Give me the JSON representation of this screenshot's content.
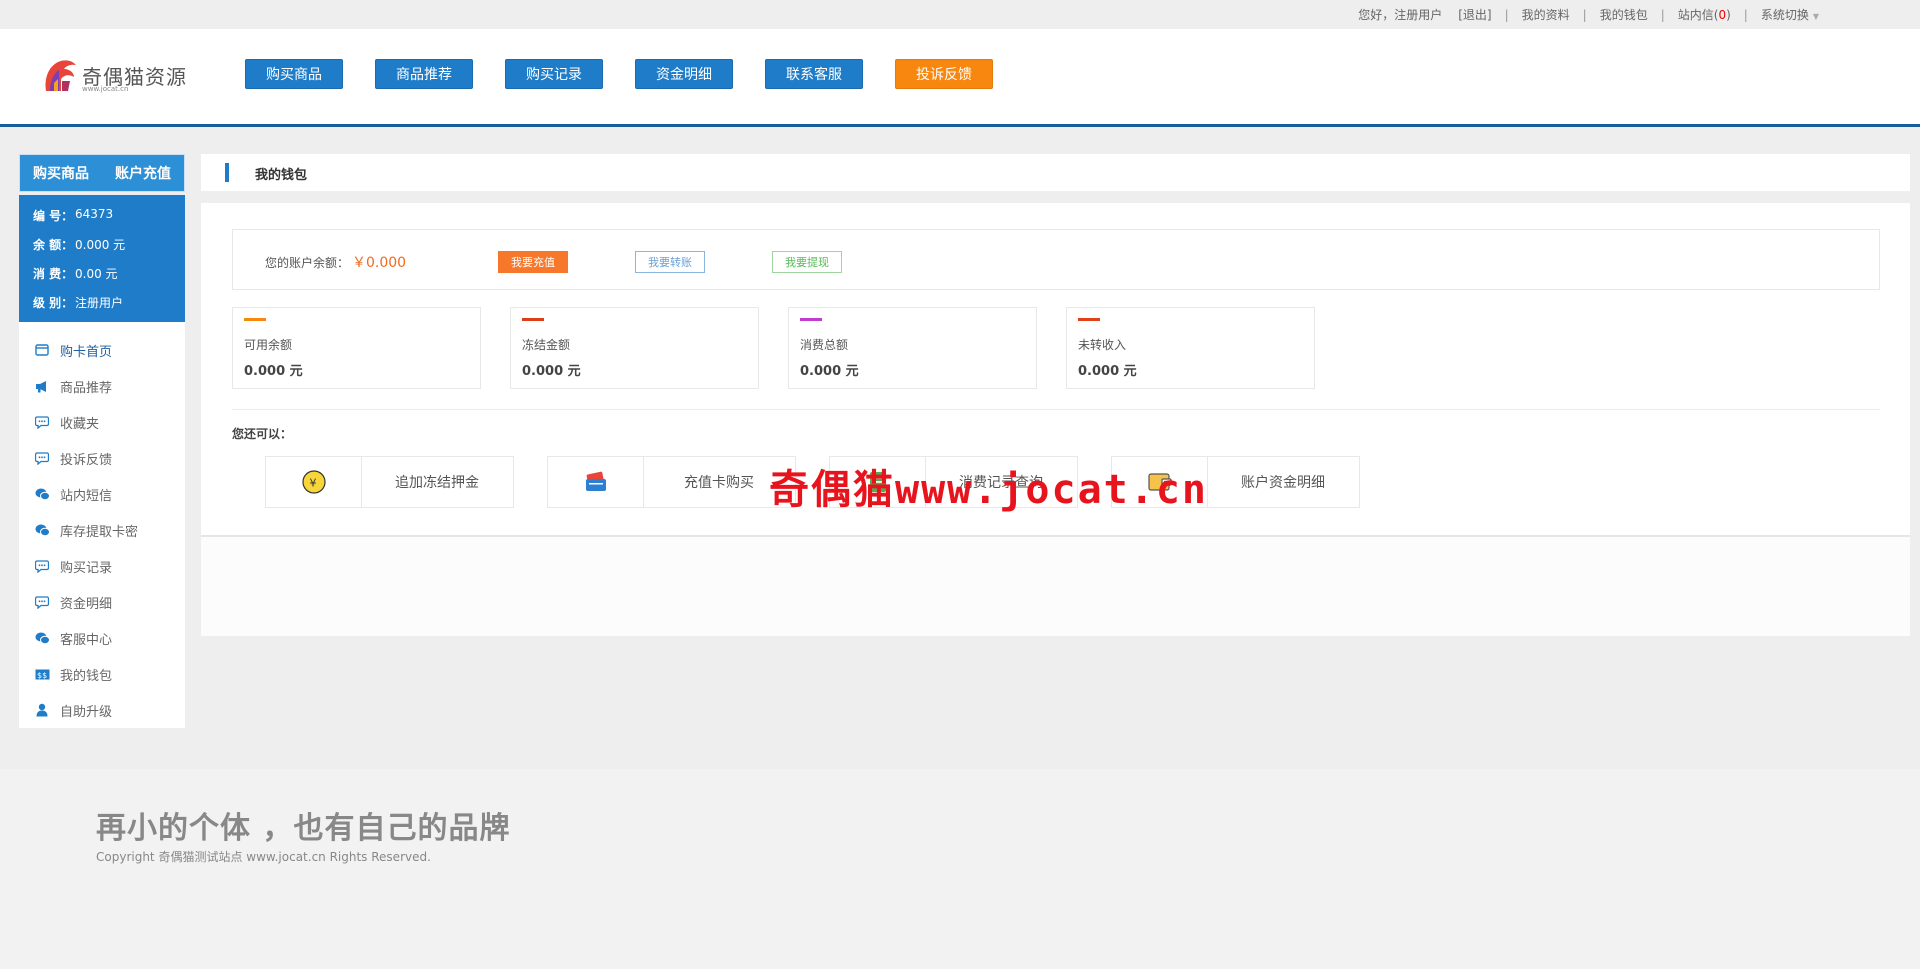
{
  "topbar": {
    "greeting": "您好，注册用户",
    "logout": "[退出]",
    "profile": "我的资料",
    "wallet": "我的钱包",
    "messages_label": "站内信(",
    "messages_count": "0",
    "messages_close": ")",
    "system_switch": "系统切换",
    "separator": "|"
  },
  "logo": {
    "name": "奇偶猫资源",
    "subtitle": "www.jocat.cn"
  },
  "nav": {
    "items": [
      "购买商品",
      "商品推荐",
      "购买记录",
      "资金明细",
      "联系客服",
      "投诉反馈"
    ]
  },
  "sidebar": {
    "tabs": [
      "购买商品",
      "账户充值"
    ],
    "info": [
      {
        "key": "编 号：",
        "value": "64373"
      },
      {
        "key": "余 额：",
        "value": "0.000 元"
      },
      {
        "key": "消 费：",
        "value": "0.00 元"
      },
      {
        "key": "级 别：",
        "value": "注册用户"
      }
    ],
    "menu": [
      {
        "label": "购卡首页",
        "icon": "card-icon"
      },
      {
        "label": "商品推荐",
        "icon": "megaphone-icon"
      },
      {
        "label": "收藏夹",
        "icon": "chat-icon"
      },
      {
        "label": "投诉反馈",
        "icon": "chat-icon"
      },
      {
        "label": "站内短信",
        "icon": "chat-bubbles-icon"
      },
      {
        "label": "库存提取卡密",
        "icon": "chat-bubbles-icon"
      },
      {
        "label": "购买记录",
        "icon": "chat-icon"
      },
      {
        "label": "资金明细",
        "icon": "chat-icon"
      },
      {
        "label": "客服中心",
        "icon": "chat-bubbles-icon"
      },
      {
        "label": "我的钱包",
        "icon": "wallet-icon"
      },
      {
        "label": "自助升级",
        "icon": "user-icon"
      }
    ]
  },
  "content": {
    "title": "我的钱包",
    "balance_label": "您的账户余额：",
    "balance_value": "￥0.000",
    "buttons": {
      "recharge": "我要充值",
      "transfer": "我要转账",
      "withdraw": "我要提现"
    },
    "stats": [
      {
        "label": "可用余额",
        "value": "0.000 元",
        "color": "#f7870f"
      },
      {
        "label": "冻结金额",
        "value": "0.000 元",
        "color": "#d9401a"
      },
      {
        "label": "消费总额",
        "value": "0.000 元",
        "color": "#c03ccf"
      },
      {
        "label": "未转收入",
        "value": "0.000 元",
        "color": "#e0401a"
      }
    ],
    "can_do": "您还可以：",
    "actions": [
      {
        "label": "追加冻结押金",
        "icon": "coin-icon"
      },
      {
        "label": "充值卡购买",
        "icon": "card-wallet-icon"
      },
      {
        "label": "消费记录查询",
        "icon": "record-icon"
      },
      {
        "label": "账户资金明细",
        "icon": "wallet-icon"
      }
    ],
    "watermark": "奇偶猫www.jocat.cn"
  },
  "footer": {
    "slogan": "再小的个体 ，也有自己的品牌",
    "copyright": "Copyright 奇偶猫测试站点 www.jocat.cn Rights Reserved."
  }
}
